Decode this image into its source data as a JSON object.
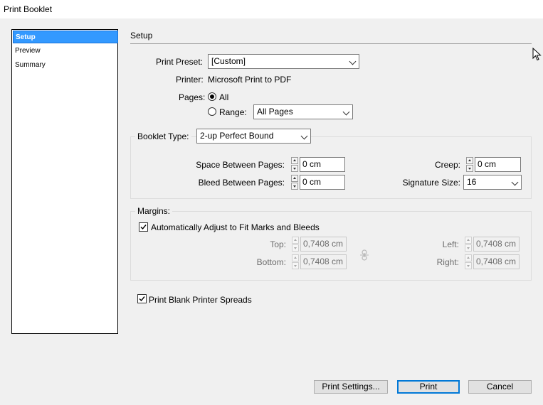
{
  "window": {
    "title": "Print Booklet"
  },
  "nav": {
    "items": [
      "Setup",
      "Preview",
      "Summary"
    ]
  },
  "section": {
    "title": "Setup"
  },
  "preset": {
    "label": "Print Preset:",
    "value": "[Custom]"
  },
  "printer": {
    "label": "Printer:",
    "value": "Microsoft Print to PDF"
  },
  "pages": {
    "label": "Pages:",
    "all_label": "All",
    "range_label": "Range:",
    "range_value": "All Pages"
  },
  "booklet": {
    "type_label": "Booklet Type:",
    "type_value": "2-up Perfect Bound",
    "space_label": "Space Between Pages:",
    "space_value": "0 cm",
    "bleed_label": "Bleed Between Pages:",
    "bleed_value": "0 cm",
    "creep_label": "Creep:",
    "creep_value": "0 cm",
    "sig_label": "Signature Size:",
    "sig_value": "16"
  },
  "margins": {
    "title": "Margins:",
    "auto_label": "Automatically Adjust to Fit Marks and Bleeds",
    "top_label": "Top:",
    "top_value": "0,7408 cm",
    "bottom_label": "Bottom:",
    "bottom_value": "0,7408 cm",
    "left_label": "Left:",
    "left_value": "0,7408 cm",
    "right_label": "Right:",
    "right_value": "0,7408 cm"
  },
  "blank": {
    "label": "Print Blank Printer Spreads"
  },
  "buttons": {
    "settings": "Print Settings...",
    "print": "Print",
    "cancel": "Cancel"
  }
}
